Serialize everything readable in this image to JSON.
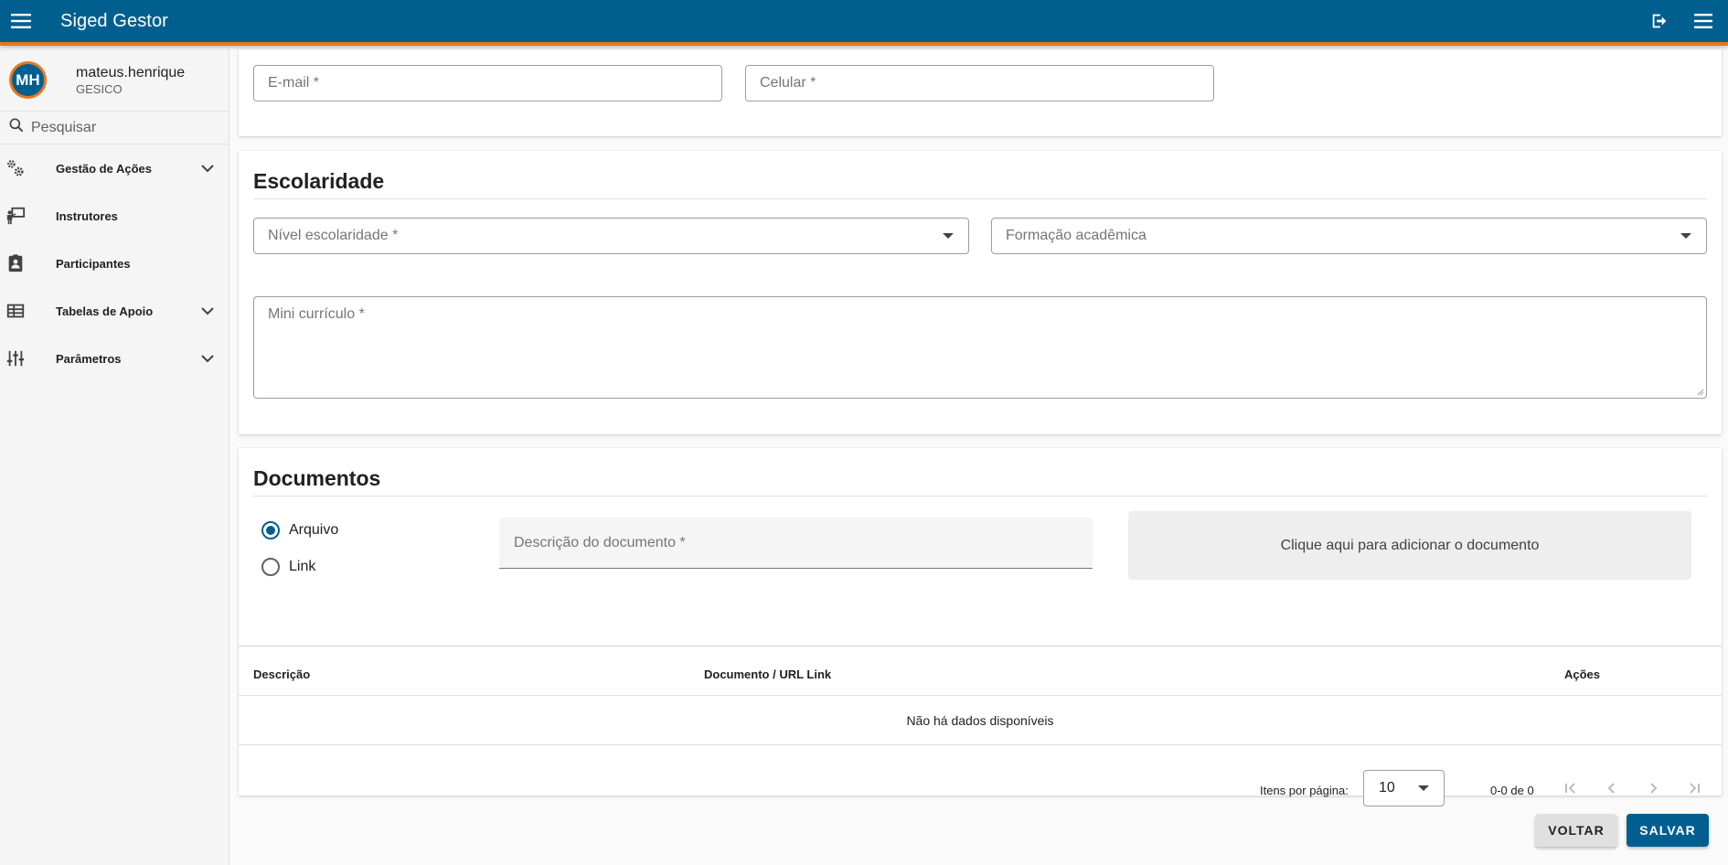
{
  "app": {
    "title": "Siged Gestor",
    "colors": {
      "primary": "#005f8f",
      "accent": "#e8771e"
    }
  },
  "user": {
    "initials": "MH",
    "name": "mateus.henrique",
    "org": "GESICO"
  },
  "sidebar": {
    "search_placeholder": "Pesquisar",
    "items": [
      {
        "label": "Gestão de Ações",
        "icon": "gears-icon",
        "expandable": true
      },
      {
        "label": "Instrutores",
        "icon": "instructor-icon",
        "expandable": false
      },
      {
        "label": "Participantes",
        "icon": "clipboard-user-icon",
        "expandable": false
      },
      {
        "label": "Tabelas de Apoio",
        "icon": "table-icon",
        "expandable": true
      },
      {
        "label": "Parâmetros",
        "icon": "tune-icon",
        "expandable": true
      }
    ]
  },
  "contact": {
    "email_placeholder": "E-mail *",
    "phone_placeholder": "Celular *"
  },
  "education": {
    "title": "Escolaridade",
    "level_placeholder": "Nível escolaridade *",
    "degree_placeholder": "Formação acadêmica",
    "resume_placeholder": "Mini currículo *"
  },
  "documents": {
    "title": "Documentos",
    "options": [
      {
        "label": "Arquivo",
        "selected": true
      },
      {
        "label": "Link",
        "selected": false
      }
    ],
    "description_placeholder": "Descrição do documento *",
    "upload_text": "Clique aqui para adicionar o documento",
    "table": {
      "columns": [
        "Descrição",
        "Documento / URL Link",
        "Ações"
      ],
      "empty": "Não há dados disponíveis"
    },
    "pagination": {
      "items_per_page_label": "Itens por página:",
      "page_size": "10",
      "range": "0-0 de 0"
    }
  },
  "actions": {
    "back": "VOLTAR",
    "save": "SALVAR"
  }
}
